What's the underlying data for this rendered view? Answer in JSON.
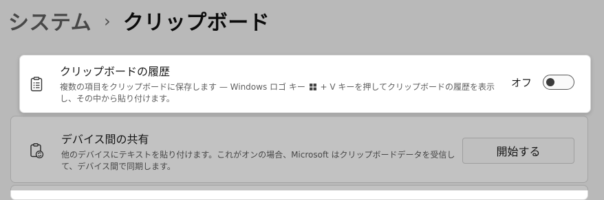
{
  "breadcrumb": {
    "parent": "システム",
    "separator": "›",
    "current": "クリップボード"
  },
  "clipboard_history": {
    "title": "クリップボードの履歴",
    "description_before_key": "複数の項目をクリップボードに保存します — Windows ロゴ キー",
    "description_after_key": "+ V キーを押してクリップボードの履歴を表示し、その中から貼り付けます。",
    "toggle_label": "オフ",
    "toggle_state": "off",
    "icon": "clipboard-list-icon"
  },
  "cross_device": {
    "title": "デバイス間の共有",
    "description": "他のデバイスにテキストを貼り付けます。これがオンの場合、Microsoft はクリップボードデータを受信して、デバイス間で同期します。",
    "button_label": "開始する",
    "icon": "clipboard-sync-icon"
  },
  "colors": {
    "dim_overlay": "#000000",
    "card_background": "#ffffff",
    "page_background": "#f3f3f3"
  }
}
